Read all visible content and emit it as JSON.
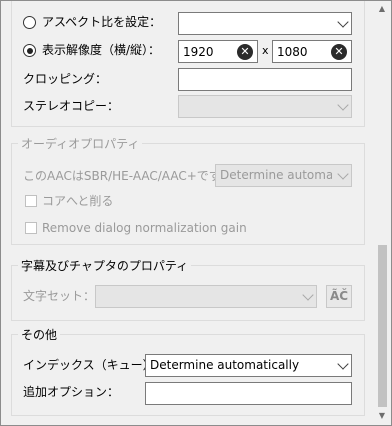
{
  "top": {
    "aspect_label": "アスペクト比を設定：",
    "aspect_value": "",
    "display_res_label": "表示解像度（横/縦）：",
    "width_value": "1920",
    "times_symbol": "x",
    "height_value": "1080",
    "clear_glyph": "✕",
    "cropping_label": "クロッピング：",
    "cropping_value": "",
    "stereo_label": "ステレオコピー：",
    "stereo_value": ""
  },
  "audio": {
    "title": "オーディオプロパティ",
    "aac_label": "このAACはSBR/HE-AAC/AAC+です：",
    "aac_value": "Determine automatic",
    "core_label": "コアへと削る",
    "normalize_label": "Remove dialog normalization gain"
  },
  "subs": {
    "title": "字幕及びチャプタのプロパティ",
    "charset_label": "文字セット：",
    "charset_value": "",
    "detect_button": "ÃČ"
  },
  "misc": {
    "title": "その他",
    "index_label": "インデックス（キュー）：",
    "index_value": "Determine automatically",
    "extra_label": "追加オプション：",
    "extra_value": ""
  },
  "colors": {
    "disabled_text": "#9a9a9a",
    "frame": "#dcdcdc"
  }
}
